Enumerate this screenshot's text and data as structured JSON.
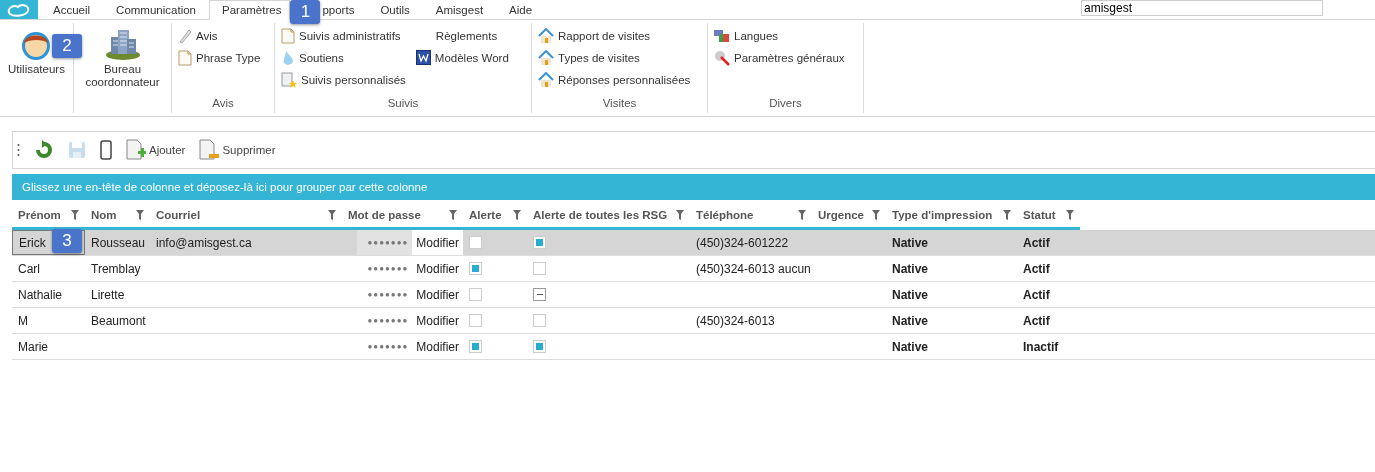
{
  "menu_tabs": [
    {
      "label": "Accueil",
      "selected": false
    },
    {
      "label": "Communication",
      "selected": false
    },
    {
      "label": "Paramètres",
      "selected": true
    },
    {
      "label": "pports",
      "selected": false
    },
    {
      "label": "Outils",
      "selected": false
    },
    {
      "label": "Amisgest",
      "selected": false
    },
    {
      "label": "Aide",
      "selected": false
    }
  ],
  "search": {
    "value": "amisgest"
  },
  "ribbon": [
    {
      "kind": "large",
      "items": [
        "Utilisateurs"
      ]
    },
    {
      "kind": "large",
      "items": [
        "Bureau coordonnateur"
      ]
    },
    {
      "kind": "small",
      "label": "Avis",
      "columns": [
        [
          "Avis",
          "Phrase Type"
        ]
      ]
    },
    {
      "kind": "small",
      "label": "Suivis",
      "columns": [
        [
          "Suivis administratifs",
          "Soutiens",
          "Suivis personnalisés"
        ],
        [
          "Règlements",
          "Modèles Word"
        ]
      ]
    },
    {
      "kind": "small",
      "label": "Visites",
      "columns": [
        [
          "Rapport de visites",
          "Types de visites",
          "Réponses personnalisées"
        ]
      ]
    },
    {
      "kind": "small",
      "label": "Divers",
      "columns": [
        [
          "Langues",
          "Paramètres généraux"
        ]
      ]
    }
  ],
  "toolbar": {
    "add": "Ajouter",
    "delete": "Supprimer",
    "save_disabled": true
  },
  "group_panel": "Glissez une en-tête de colonne et déposez-là ici pour grouper par cette colonne",
  "table": {
    "columns": [
      "Prénom",
      "Nom",
      "Courriel",
      "Mot de passe",
      "Alerte",
      "Alerte de toutes les RSG",
      "Téléphone",
      "Urgence",
      "Type d'impression",
      "Statut"
    ],
    "rows": [
      {
        "selected": true,
        "first_name": "Erick",
        "last_name": "Rousseau",
        "email": "info@amisgest.ca",
        "password": "●●●●●●●",
        "edit": "Modifier",
        "alert": {
          "checked": false,
          "indeterminate": false
        },
        "rsg_alert": {
          "checked": true,
          "indeterminate": false
        },
        "phone": "(450)324-601222",
        "print_type": "Native",
        "status": "Actif"
      },
      {
        "selected": false,
        "first_name": "Carl",
        "last_name": "Tremblay",
        "password": "●●●●●●●",
        "edit": "Modifier",
        "alert": {
          "checked": true,
          "indeterminate": false
        },
        "rsg_alert": {
          "checked": false,
          "indeterminate": false
        },
        "phone": "(450)324-6013 aucun",
        "print_type": "Native",
        "status": "Actif"
      },
      {
        "selected": false,
        "first_name": "Nathalie",
        "last_name": "Lirette",
        "password": "●●●●●●●",
        "edit": "Modifier",
        "alert": {
          "checked": false,
          "indeterminate": false
        },
        "rsg_alert": {
          "checked": false,
          "indeterminate": true
        },
        "print_type": "Native",
        "status": "Actif"
      },
      {
        "selected": false,
        "first_name": "M",
        "last_name": "Beaumont",
        "password": "●●●●●●●",
        "edit": "Modifier",
        "alert": {
          "checked": false,
          "indeterminate": false
        },
        "rsg_alert": {
          "checked": false,
          "indeterminate": false
        },
        "phone": "(450)324-6013",
        "print_type": "Native",
        "status": "Actif"
      },
      {
        "selected": false,
        "first_name": "Marie",
        "password": "●●●●●●●",
        "edit": "Modifier",
        "alert": {
          "checked": true,
          "indeterminate": false
        },
        "rsg_alert": {
          "checked": true,
          "indeterminate": false
        },
        "print_type": "Native",
        "status": "Inactif"
      }
    ]
  },
  "callouts": [
    "1",
    "2",
    "3"
  ]
}
